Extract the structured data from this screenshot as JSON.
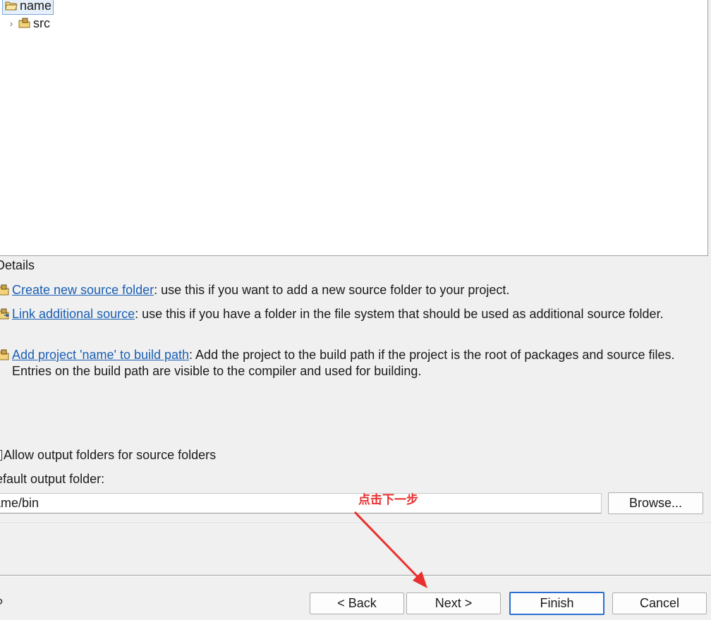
{
  "tree": {
    "root_label": "name",
    "child_label": "src"
  },
  "details": {
    "heading": "Details",
    "items": [
      {
        "link": "Create new source folder",
        "text": ": use this if you want to add a new source folder to your project."
      },
      {
        "link": "Link additional source",
        "text": ": use this if you have a folder in the file system that should be used as additional source folder."
      },
      {
        "link": "Add project 'name' to build path",
        "text": ": Add the project to the build path if the project is the root of packages and source files. Entries on the build path are visible to the compiler and used for building."
      }
    ]
  },
  "output": {
    "allow_label": "Allow output folders for source folders",
    "default_label": "efault output folder:",
    "folder_value": "ame/bin",
    "browse_label": "Browse..."
  },
  "footer": {
    "help_glyph": "?",
    "back_label": "< Back",
    "next_label": "Next >",
    "finish_label": "Finish",
    "cancel_label": "Cancel"
  },
  "annotation": {
    "text": "点击下一步",
    "color": "#e8302f"
  },
  "colors": {
    "link": "#1a5fb4",
    "default_button_border": "#2a6fd1",
    "folder_icon": "#e8b84a"
  }
}
